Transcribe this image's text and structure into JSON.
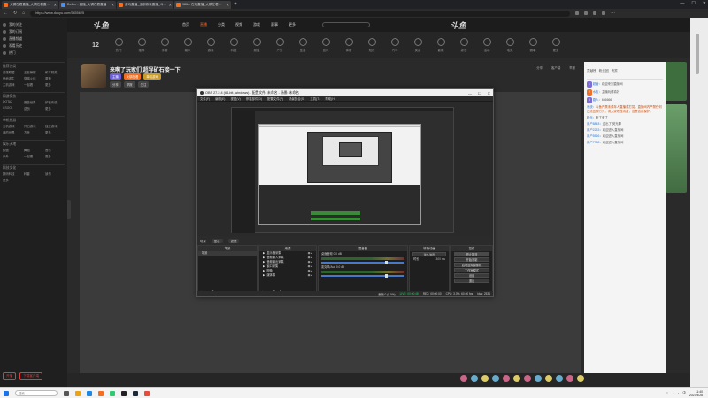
{
  "browser": {
    "tabs": [
      {
        "title": "火锅在看直播_火锅在看直播精彩视频",
        "active": false
      },
      {
        "title": "Detlee - 直播_火锅在看直播",
        "active": false
      },
      {
        "title": "游戏直播_全部游戏直播_斗鱼直播",
        "active": false
      },
      {
        "title": "98lb - 在玩直播_火锅在看直播",
        "active": true
      }
    ],
    "url": "https://www.douyu.com/5455625"
  },
  "site": {
    "logo": "斗鱼",
    "logo_right": "斗鱼",
    "nav": [
      {
        "label": "首页",
        "active": false
      },
      {
        "label": "直播",
        "active": true
      },
      {
        "label": "分类",
        "active": false
      },
      {
        "label": "视频",
        "active": false
      },
      {
        "label": "游戏",
        "active": false
      },
      {
        "label": "赛事",
        "active": false
      },
      {
        "label": "更多",
        "active": false
      }
    ],
    "category_count": "12",
    "categories": [
      "热门",
      "推荐",
      "手游",
      "娱乐",
      "游戏",
      "科技",
      "颜值",
      "户外",
      "生活",
      "音乐",
      "体育",
      "知识",
      "汽车",
      "美食",
      "影视",
      "综艺",
      "活动",
      "电竞",
      "赛事",
      "更多"
    ]
  },
  "sidebar": {
    "items": [
      "我的关注",
      "我的订阅",
      "直播频道",
      "观看历史",
      "热门"
    ],
    "sections": [
      {
        "title": "推荐分类",
        "items": [
          "英雄联盟",
          "王者荣耀",
          "和平精英",
          "绝地求生",
          "穿越火线",
          "原神",
          "主机游戏",
          "一起看",
          "更多"
        ]
      },
      {
        "title": "网游竞技",
        "items": [
          "DOTA2",
          "魔兽世界",
          "炉石传说",
          "CSGO",
          "逆战",
          "更多"
        ]
      },
      {
        "title": "单机热游",
        "items": [
          "主机游戏",
          "怀旧游戏",
          "独立游戏",
          "我的世界",
          "方舟",
          "更多"
        ]
      },
      {
        "title": "娱乐天地",
        "items": [
          "颜值",
          "舞蹈",
          "音乐",
          "户外",
          "一起看",
          "更多"
        ]
      },
      {
        "title": "科技文化",
        "items": [
          "数码科技",
          "科普",
          "读书",
          "更多"
        ]
      }
    ],
    "footer_buttons": [
      "开播",
      "下载客户端"
    ]
  },
  "room": {
    "title": "来啊了玩家们 超导矿石接一下",
    "tags": [
      {
        "label": "主播",
        "style": "purple"
      },
      {
        "label": "火锅在看",
        "style": "orange"
      },
      {
        "label": "单机游戏",
        "style": "yellow"
      }
    ],
    "tags_secondary": [
      "分享",
      "举报",
      "关注"
    ],
    "right_links": [
      "分享",
      "客户端",
      "举报"
    ]
  },
  "obs": {
    "title": "OBS 27.2.4 (64-bit, windows) - 配置文件: 未命名 - 场景: 未命名",
    "menu": [
      "文件(F)",
      "编辑(E)",
      "视图(V)",
      "停靠部件(D)",
      "配置文件(P)",
      "场景集合(S)",
      "工具(T)",
      "帮助(H)"
    ],
    "scene_bar_label": "场景",
    "scene_buttons": [
      "显示",
      "滤镜"
    ],
    "docks": {
      "scenes": {
        "title": "场景",
        "items": [
          "场景"
        ]
      },
      "sources": {
        "title": "来源",
        "items": [
          "显示器采集",
          "音频输入采集",
          "音频输出采集",
          "窗口采集",
          "图像",
          "媒体源"
        ]
      },
      "mixer": {
        "title": "混音器",
        "channels": [
          {
            "name": "桌面音频",
            "level": "0.0 dB"
          },
          {
            "name": "麦克风/Aux",
            "level": "0.0 dB"
          }
        ]
      },
      "transitions": {
        "title": "转场动画",
        "type": "淡入淡出",
        "duration_label": "时长",
        "duration": "300 ms"
      },
      "controls": {
        "title": "控件",
        "buttons": [
          "停止推流",
          "开始录制",
          "启动虚拟摄像机",
          "工作室模式",
          "设置",
          "退出"
        ]
      }
    },
    "status": {
      "dropped": "丢帧 0 (0.0%)",
      "live": "LIVE: 00:00:48",
      "rec": "REC: 00:00:00",
      "cpu": "CPU: 3.3%, 60.00 fps",
      "kbps": "kb/s: 2531"
    }
  },
  "chat": {
    "header": [
      "贡献榜",
      "粉丝团",
      "贵宾"
    ],
    "lines": [
      {
        "user": "超管",
        "text": "欢迎来到直播间",
        "badge": "1"
      },
      {
        "user": "水友",
        "text": "主播玩得真好",
        "badge": "2"
      },
      {
        "user": "路人",
        "text": "666666",
        "badge": "3"
      },
      {
        "user": "系统",
        "text": "斗鱼严禁未成年人直播或打赏，直播间内严禁任何违法违规行为，请大家理性消费，注意自我保护。",
        "badge": ""
      },
      {
        "user": "粉丝",
        "text": "来了来了",
        "badge": ""
      },
      {
        "user": "用户8848",
        "text": "送出了 荧光棒",
        "badge": ""
      },
      {
        "user": "用户2233",
        "text": "欢迎进入直播间",
        "badge": ""
      },
      {
        "user": "用户5566",
        "text": "欢迎进入直播间",
        "badge": ""
      },
      {
        "user": "用户7788",
        "text": "欢迎进入直播间",
        "badge": ""
      }
    ]
  },
  "taskbar": {
    "search_placeholder": "搜索",
    "time": "11:40",
    "date": "2023/4/28",
    "lang": "中"
  },
  "colors": {
    "accent": "#f36e21",
    "purple": "#7c6bd6",
    "obs_bg": "#2b2b2b"
  }
}
